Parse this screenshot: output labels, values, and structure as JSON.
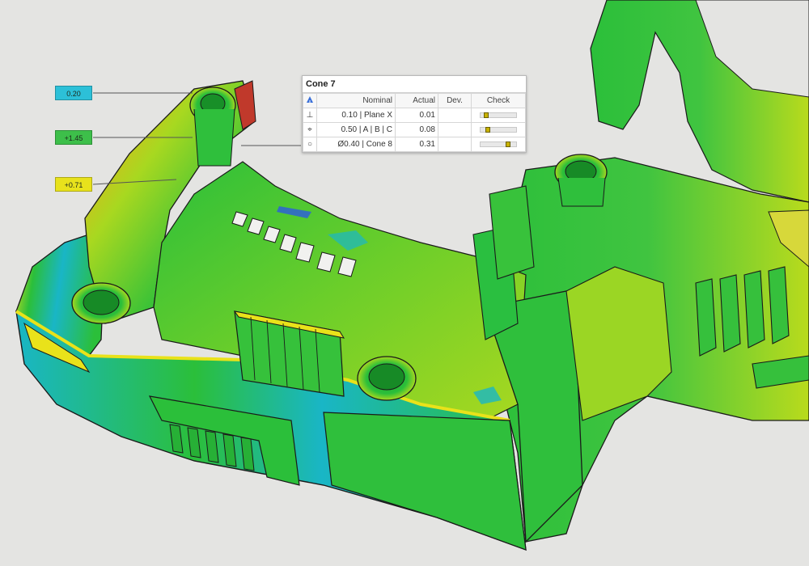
{
  "scene": {
    "background": "#e4e4e2",
    "colors": {
      "green": "#2bbf3a",
      "yellow_green": "#a8d820",
      "yellow": "#e9e21a",
      "cyan": "#19b6c6",
      "blue": "#2c5be0",
      "red": "#c0392b",
      "edge": "#1a1a1a"
    }
  },
  "callouts": [
    {
      "label": "0.20",
      "color": "#2cc0d8"
    },
    {
      "label": "+1.45",
      "color": "#3dbf4a"
    },
    {
      "label": "+0.71",
      "color": "#e8e21c"
    }
  ],
  "gdt_panel": {
    "title": "Cone 7",
    "columns": {
      "nominal": "Nominal",
      "actual": "Actual",
      "deviation": "Dev.",
      "check": "Check"
    },
    "header_icon": "datum-triangle-icon",
    "rows": [
      {
        "icon": "perpendicularity-icon",
        "glyph": "⊥",
        "nominal": "0.10 | Plane X",
        "actual": "0.01",
        "deviation": "",
        "check_fraction": 0.1
      },
      {
        "icon": "position-icon",
        "glyph": "⌖",
        "nominal": "0.50 | A | B | C",
        "actual": "0.08",
        "deviation": "",
        "check_fraction": 0.16
      },
      {
        "icon": "circularity-icon",
        "glyph": "○",
        "nominal": "Ø0.40 | Cone 8",
        "actual": "0.31",
        "deviation": "",
        "check_fraction": 0.78
      }
    ]
  }
}
